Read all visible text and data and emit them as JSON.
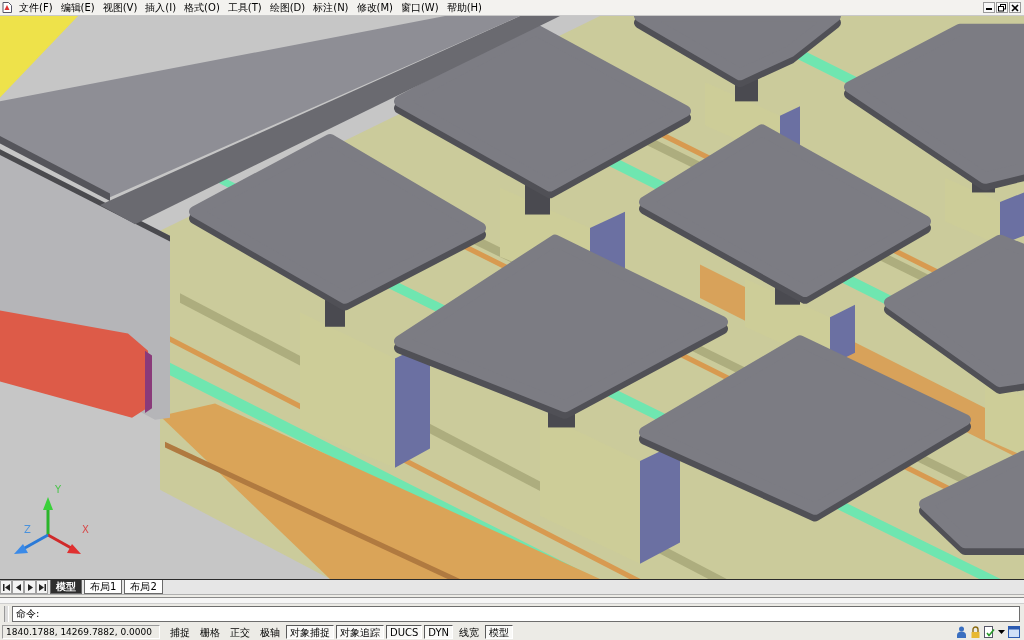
{
  "menu_bar": {
    "items": [
      "文件(F)",
      "编辑(E)",
      "视图(V)",
      "插入(I)",
      "格式(O)",
      "工具(T)",
      "绘图(D)",
      "标注(N)",
      "修改(M)",
      "窗口(W)",
      "帮助(H)"
    ]
  },
  "viewport": {
    "axis_labels": [
      {
        "kind": "y",
        "text": "Y"
      },
      {
        "kind": "z",
        "text": "Z"
      },
      {
        "kind": "x",
        "text": "X"
      }
    ]
  },
  "layout_tabs": [
    {
      "label": "模型",
      "selected": true
    },
    {
      "label": "布局1",
      "selected": false
    },
    {
      "label": "布局2",
      "selected": false
    }
  ],
  "command_line": {
    "prompt": "命令:"
  },
  "status_bar": {
    "coordinates": "1840.1788, 14269.7882, 0.0000",
    "toggles": [
      {
        "label": "捕捉",
        "on": false
      },
      {
        "label": "栅格",
        "on": false
      },
      {
        "label": "正交",
        "on": false
      },
      {
        "label": "极轴",
        "on": false
      },
      {
        "label": "对象捕捉",
        "on": true
      },
      {
        "label": "对象追踪",
        "on": true
      },
      {
        "label": "DUCS",
        "on": true
      },
      {
        "label": "DYN",
        "on": true
      },
      {
        "label": "线宽",
        "on": false
      },
      {
        "label": "模型",
        "on": true
      }
    ]
  }
}
